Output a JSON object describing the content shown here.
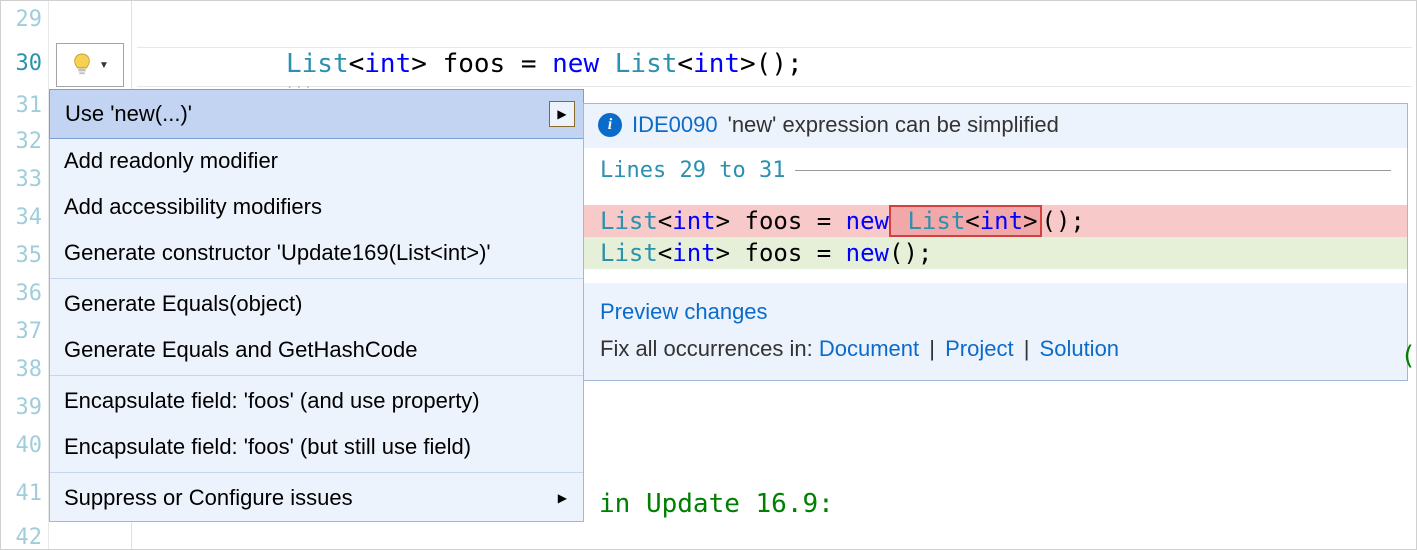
{
  "line_numbers": [
    "29",
    "30",
    "31",
    "32",
    "33",
    "34",
    "35",
    "36",
    "37",
    "38",
    "39",
    "40",
    "41",
    "42"
  ],
  "code_line_30": {
    "t1": "List",
    "t2": "<",
    "t3": "int",
    "t4": "> ",
    "id": "foos",
    "sp": " = ",
    "kw": "new",
    "sp2": " ",
    "t5": "List",
    "t6": "<",
    "t7": "int",
    "t8": ">();"
  },
  "dots": "...",
  "bulb_caret": "▼",
  "menu": {
    "items": [
      "Use 'new(...)'",
      "Add readonly modifier",
      "Add accessibility modifiers",
      "Generate constructor 'Update169(List<int>)'",
      "Generate Equals(object)",
      "Generate Equals and GetHashCode",
      "Encapsulate field: 'foos' (and use property)",
      "Encapsulate field: 'foos' (but still use field)",
      "Suppress or Configure issues"
    ],
    "arrow_glyph": "▶"
  },
  "preview": {
    "info_glyph": "i",
    "code": "IDE0090",
    "message": "'new' expression can be simplified",
    "lines_label_a": "Lines ",
    "lines_label_b": "29",
    "lines_label_c": " to ",
    "lines_label_d": "31",
    "diff_before": {
      "a": "List",
      "b": "<",
      "c": "int",
      "d": "> foos = ",
      "e": "new",
      "f": " ",
      "g": "List",
      "h": "<",
      "i": "int",
      "j": ">",
      "k": "();"
    },
    "diff_after": {
      "a": "List",
      "b": "<",
      "c": "int",
      "d": "> foos = ",
      "e": "new",
      "f": "();"
    },
    "footer": {
      "preview_changes": "Preview changes",
      "fix_prefix": "Fix all occurrences in: ",
      "doc": "Document",
      "proj": "Project",
      "sol": "Solution",
      "sep": " | "
    }
  },
  "below_comment": "in Update 16.9:",
  "edge_paren": "("
}
